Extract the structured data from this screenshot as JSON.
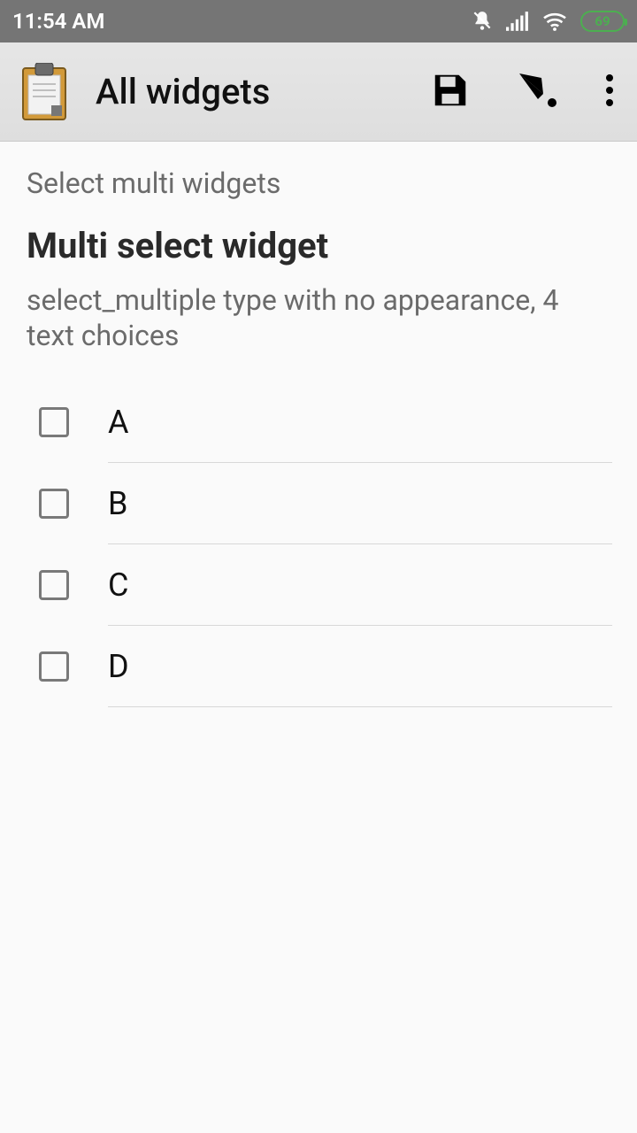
{
  "status": {
    "time": "11:54 AM",
    "battery": "69"
  },
  "appbar": {
    "title": "All widgets"
  },
  "content": {
    "group_label": "Select multi widgets",
    "question_title": "Multi select widget",
    "question_desc": "select_multiple type with no appearance, 4 text choices",
    "choices": [
      {
        "label": "A"
      },
      {
        "label": "B"
      },
      {
        "label": "C"
      },
      {
        "label": "D"
      }
    ]
  }
}
